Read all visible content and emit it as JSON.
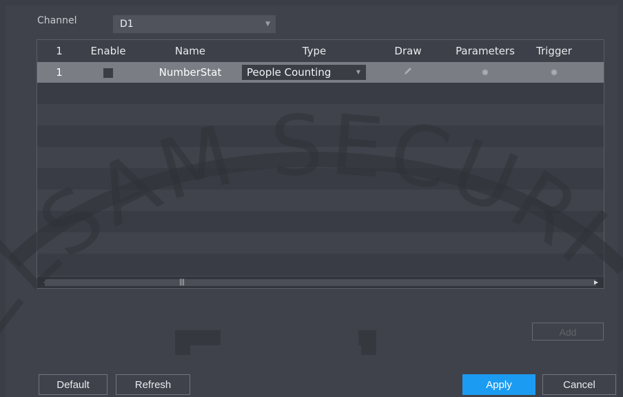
{
  "channel": {
    "label": "Channel",
    "value": "D1"
  },
  "table": {
    "headers": [
      "1",
      "Enable",
      "Name",
      "Type",
      "Draw",
      "Parameters",
      "Trigger"
    ],
    "rows": [
      {
        "index": "1",
        "enabled": false,
        "name": "NumberStat",
        "type": "People Counting",
        "draw_icon": "pencil-icon",
        "parameters_icon": "gear-icon",
        "trigger_icon": "gear-icon"
      }
    ]
  },
  "buttons": {
    "add": "Add",
    "default": "Default",
    "refresh": "Refresh",
    "apply": "Apply",
    "cancel": "Cancel"
  },
  "watermark": {
    "text": "ELSAM SECURI"
  },
  "colors": {
    "accent": "#1b9cf2",
    "selected_row": "#7a7d84",
    "background": "#3f424a"
  }
}
